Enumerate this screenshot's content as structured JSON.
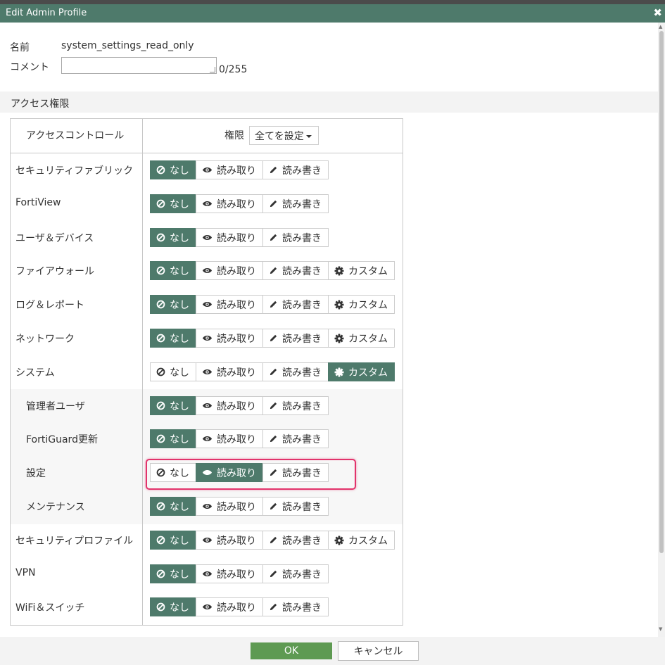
{
  "window": {
    "title": "Edit Admin Profile",
    "close_label": "✖"
  },
  "form": {
    "name_label": "名前",
    "name_value": "system_settings_read_only",
    "comment_label": "コメント",
    "comment_value": "",
    "comment_count": "0/255"
  },
  "section_title": "アクセス権限",
  "table": {
    "header_left": "アクセスコントロール",
    "header_perm": "権限",
    "set_all_label": "全てを設定"
  },
  "buttons": {
    "none": "なし",
    "read": "読み取り",
    "write": "読み書き",
    "custom": "カスタム"
  },
  "rows": [
    {
      "label": "セキュリティファブリック",
      "selected": "none",
      "custom": false,
      "sub": false
    },
    {
      "label": "FortiView",
      "selected": "none",
      "custom": false,
      "sub": false
    },
    {
      "label": "ユーザ＆デバイス",
      "selected": "none",
      "custom": false,
      "sub": false
    },
    {
      "label": "ファイアウォール",
      "selected": "none",
      "custom": true,
      "sub": false
    },
    {
      "label": "ログ＆レポート",
      "selected": "none",
      "custom": true,
      "sub": false
    },
    {
      "label": "ネットワーク",
      "selected": "none",
      "custom": true,
      "sub": false
    },
    {
      "label": "システム",
      "selected": "custom",
      "custom": true,
      "sub": false
    },
    {
      "label": "管理者ユーザ",
      "selected": "none",
      "custom": false,
      "sub": true
    },
    {
      "label": "FortiGuard更新",
      "selected": "none",
      "custom": false,
      "sub": true
    },
    {
      "label": "設定",
      "selected": "read",
      "custom": false,
      "sub": true
    },
    {
      "label": "メンテナンス",
      "selected": "none",
      "custom": false,
      "sub": true
    },
    {
      "label": "セキュリティプロファイル",
      "selected": "none",
      "custom": true,
      "sub": false
    },
    {
      "label": "VPN",
      "selected": "none",
      "custom": false,
      "sub": false
    },
    {
      "label": "WiFi＆スイッチ",
      "selected": "none",
      "custom": false,
      "sub": false
    }
  ],
  "footer": {
    "ok_label": "OK",
    "cancel_label": "キャンセル"
  },
  "colors": {
    "accent": "#4e7a6b",
    "ok": "#5e9a52",
    "highlight": "#e2336b"
  },
  "icons": {
    "none": "ban-icon",
    "read": "eye-icon",
    "write": "pencil-icon",
    "custom": "gear-icon"
  }
}
